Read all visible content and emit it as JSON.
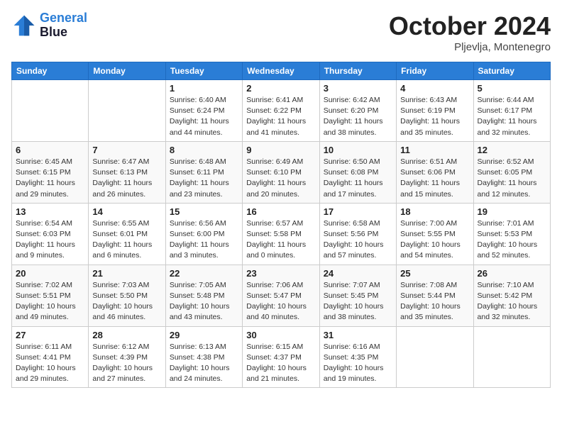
{
  "header": {
    "logo_line1": "General",
    "logo_line2": "Blue",
    "month_title": "October 2024",
    "location": "Pljevlja, Montenegro"
  },
  "weekdays": [
    "Sunday",
    "Monday",
    "Tuesday",
    "Wednesday",
    "Thursday",
    "Friday",
    "Saturday"
  ],
  "weeks": [
    [
      {
        "day": null
      },
      {
        "day": null
      },
      {
        "day": "1",
        "sunrise": "Sunrise: 6:40 AM",
        "sunset": "Sunset: 6:24 PM",
        "daylight": "Daylight: 11 hours and 44 minutes."
      },
      {
        "day": "2",
        "sunrise": "Sunrise: 6:41 AM",
        "sunset": "Sunset: 6:22 PM",
        "daylight": "Daylight: 11 hours and 41 minutes."
      },
      {
        "day": "3",
        "sunrise": "Sunrise: 6:42 AM",
        "sunset": "Sunset: 6:20 PM",
        "daylight": "Daylight: 11 hours and 38 minutes."
      },
      {
        "day": "4",
        "sunrise": "Sunrise: 6:43 AM",
        "sunset": "Sunset: 6:19 PM",
        "daylight": "Daylight: 11 hours and 35 minutes."
      },
      {
        "day": "5",
        "sunrise": "Sunrise: 6:44 AM",
        "sunset": "Sunset: 6:17 PM",
        "daylight": "Daylight: 11 hours and 32 minutes."
      }
    ],
    [
      {
        "day": "6",
        "sunrise": "Sunrise: 6:45 AM",
        "sunset": "Sunset: 6:15 PM",
        "daylight": "Daylight: 11 hours and 29 minutes."
      },
      {
        "day": "7",
        "sunrise": "Sunrise: 6:47 AM",
        "sunset": "Sunset: 6:13 PM",
        "daylight": "Daylight: 11 hours and 26 minutes."
      },
      {
        "day": "8",
        "sunrise": "Sunrise: 6:48 AM",
        "sunset": "Sunset: 6:11 PM",
        "daylight": "Daylight: 11 hours and 23 minutes."
      },
      {
        "day": "9",
        "sunrise": "Sunrise: 6:49 AM",
        "sunset": "Sunset: 6:10 PM",
        "daylight": "Daylight: 11 hours and 20 minutes."
      },
      {
        "day": "10",
        "sunrise": "Sunrise: 6:50 AM",
        "sunset": "Sunset: 6:08 PM",
        "daylight": "Daylight: 11 hours and 17 minutes."
      },
      {
        "day": "11",
        "sunrise": "Sunrise: 6:51 AM",
        "sunset": "Sunset: 6:06 PM",
        "daylight": "Daylight: 11 hours and 15 minutes."
      },
      {
        "day": "12",
        "sunrise": "Sunrise: 6:52 AM",
        "sunset": "Sunset: 6:05 PM",
        "daylight": "Daylight: 11 hours and 12 minutes."
      }
    ],
    [
      {
        "day": "13",
        "sunrise": "Sunrise: 6:54 AM",
        "sunset": "Sunset: 6:03 PM",
        "daylight": "Daylight: 11 hours and 9 minutes."
      },
      {
        "day": "14",
        "sunrise": "Sunrise: 6:55 AM",
        "sunset": "Sunset: 6:01 PM",
        "daylight": "Daylight: 11 hours and 6 minutes."
      },
      {
        "day": "15",
        "sunrise": "Sunrise: 6:56 AM",
        "sunset": "Sunset: 6:00 PM",
        "daylight": "Daylight: 11 hours and 3 minutes."
      },
      {
        "day": "16",
        "sunrise": "Sunrise: 6:57 AM",
        "sunset": "Sunset: 5:58 PM",
        "daylight": "Daylight: 11 hours and 0 minutes."
      },
      {
        "day": "17",
        "sunrise": "Sunrise: 6:58 AM",
        "sunset": "Sunset: 5:56 PM",
        "daylight": "Daylight: 10 hours and 57 minutes."
      },
      {
        "day": "18",
        "sunrise": "Sunrise: 7:00 AM",
        "sunset": "Sunset: 5:55 PM",
        "daylight": "Daylight: 10 hours and 54 minutes."
      },
      {
        "day": "19",
        "sunrise": "Sunrise: 7:01 AM",
        "sunset": "Sunset: 5:53 PM",
        "daylight": "Daylight: 10 hours and 52 minutes."
      }
    ],
    [
      {
        "day": "20",
        "sunrise": "Sunrise: 7:02 AM",
        "sunset": "Sunset: 5:51 PM",
        "daylight": "Daylight: 10 hours and 49 minutes."
      },
      {
        "day": "21",
        "sunrise": "Sunrise: 7:03 AM",
        "sunset": "Sunset: 5:50 PM",
        "daylight": "Daylight: 10 hours and 46 minutes."
      },
      {
        "day": "22",
        "sunrise": "Sunrise: 7:05 AM",
        "sunset": "Sunset: 5:48 PM",
        "daylight": "Daylight: 10 hours and 43 minutes."
      },
      {
        "day": "23",
        "sunrise": "Sunrise: 7:06 AM",
        "sunset": "Sunset: 5:47 PM",
        "daylight": "Daylight: 10 hours and 40 minutes."
      },
      {
        "day": "24",
        "sunrise": "Sunrise: 7:07 AM",
        "sunset": "Sunset: 5:45 PM",
        "daylight": "Daylight: 10 hours and 38 minutes."
      },
      {
        "day": "25",
        "sunrise": "Sunrise: 7:08 AM",
        "sunset": "Sunset: 5:44 PM",
        "daylight": "Daylight: 10 hours and 35 minutes."
      },
      {
        "day": "26",
        "sunrise": "Sunrise: 7:10 AM",
        "sunset": "Sunset: 5:42 PM",
        "daylight": "Daylight: 10 hours and 32 minutes."
      }
    ],
    [
      {
        "day": "27",
        "sunrise": "Sunrise: 6:11 AM",
        "sunset": "Sunset: 4:41 PM",
        "daylight": "Daylight: 10 hours and 29 minutes."
      },
      {
        "day": "28",
        "sunrise": "Sunrise: 6:12 AM",
        "sunset": "Sunset: 4:39 PM",
        "daylight": "Daylight: 10 hours and 27 minutes."
      },
      {
        "day": "29",
        "sunrise": "Sunrise: 6:13 AM",
        "sunset": "Sunset: 4:38 PM",
        "daylight": "Daylight: 10 hours and 24 minutes."
      },
      {
        "day": "30",
        "sunrise": "Sunrise: 6:15 AM",
        "sunset": "Sunset: 4:37 PM",
        "daylight": "Daylight: 10 hours and 21 minutes."
      },
      {
        "day": "31",
        "sunrise": "Sunrise: 6:16 AM",
        "sunset": "Sunset: 4:35 PM",
        "daylight": "Daylight: 10 hours and 19 minutes."
      },
      {
        "day": null
      },
      {
        "day": null
      }
    ]
  ]
}
